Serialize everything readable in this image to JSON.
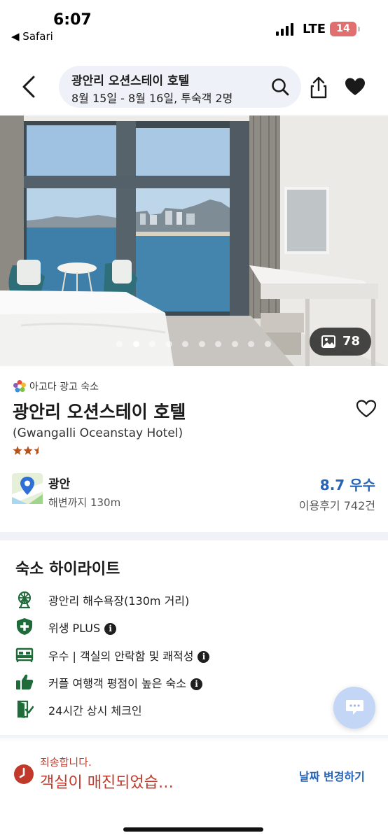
{
  "status_bar": {
    "time": "6:07",
    "back_app": "◀ Safari",
    "network": "LTE",
    "battery": "14"
  },
  "header": {
    "title": "광안리 오션스테이 호텔",
    "subtitle": "8월 15일 - 8월 16일, 투숙객 2명",
    "icons": [
      "back-icon",
      "search-icon",
      "share-icon",
      "heart-icon"
    ]
  },
  "gallery": {
    "photo_count": "78",
    "dot_count": 10,
    "active_dot": 1
  },
  "hotel": {
    "ad_tag": "아고다 광고 숙소",
    "name": "광안리 오션스테이 호텔",
    "name_en": "(Gwangalli Oceanstay Hotel)",
    "stars": 2.5,
    "location": "광안",
    "location_detail": "해변까지 130m",
    "rating": "8.7 우수",
    "reviews": "이용후기 742건"
  },
  "highlights": {
    "title": "숙소 하이라이트",
    "items": [
      {
        "icon": "ferris-wheel-icon",
        "label": "광안리 해수욕장(130m 거리)",
        "info": false
      },
      {
        "icon": "health-shield-icon",
        "label": "위생 PLUS",
        "info": true
      },
      {
        "icon": "bed-icon",
        "label": "우수 | 객실의 안락함 및 쾌적성",
        "info": true
      },
      {
        "icon": "thumbs-up-icon",
        "label": "커플 여행객 평점이 높은 숙소",
        "info": true
      },
      {
        "icon": "checkin-door-icon",
        "label": "24시간 상시 체크인",
        "info": false
      }
    ],
    "info_glyph": "i"
  },
  "bottom_bar": {
    "sorry": "죄송합니다.",
    "sold_out": "객실이 매진되었습…",
    "change_date": "날짜 변경하기"
  },
  "colors": {
    "accent_blue": "#2363b8",
    "alert_red": "#c0392b",
    "highlight_green": "#1f6b3a",
    "star_orange": "#b5531c"
  }
}
